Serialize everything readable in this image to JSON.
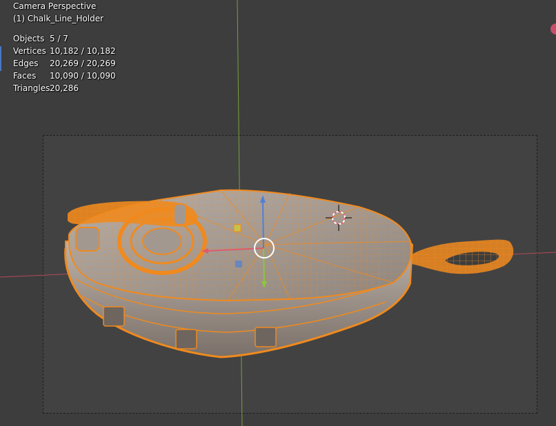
{
  "viewport": {
    "view_name": "Camera Perspective",
    "object_name": "(1) Chalk_Line_Holder",
    "stats": [
      {
        "label": "Objects",
        "value": "5 / 7"
      },
      {
        "label": "Vertices",
        "value": "10,182 / 10,182"
      },
      {
        "label": "Edges",
        "value": "20,269 / 20,269"
      },
      {
        "label": "Faces",
        "value": "10,090 / 10,090"
      },
      {
        "label": "Triangles",
        "value": "20,286"
      }
    ]
  },
  "colors": {
    "background": "#3d3d3d",
    "camera_frame": "#424242",
    "selection_wire": "#f08a1e",
    "mesh_body": "#9a8f86",
    "axis_x": "#b54a5a",
    "axis_y": "#7aa13c",
    "gizmo_z": "#4f7fd8",
    "gizmo_y": "#8cc63f",
    "gizmo_x": "#e05a6a"
  },
  "icons": {
    "cursor": "3d-cursor-icon",
    "transform_gizmo": "move-gizmo-icon",
    "navigation_gizmo": "navigation-gizmo-icon"
  }
}
